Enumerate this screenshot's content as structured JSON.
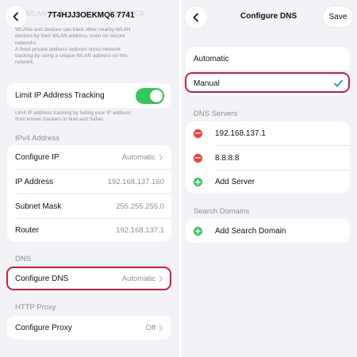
{
  "left": {
    "title": "7T4HJJ3OEKMQ6 7741",
    "title_behind": "WLAN AD    WLAN ADDR    MQG ATCA",
    "privacy_note_line1": "WLANs and devices can track other nearby WLAN",
    "privacy_note_line2": "devices by their WLAN address, even on secure",
    "privacy_note_line3": "networks.",
    "privacy_note_line4": "A fixed private address reduces cross-network",
    "privacy_note_line5": "tracking by using a unique WLAN address on this",
    "privacy_note_line6": "network.",
    "limit_tracking_label": "Limit IP Address Tracking",
    "limit_tracking_enabled": true,
    "limit_note_line1": "Limit IP address tracking by hiding your IP address",
    "limit_note_line2": "from known trackers in Mail and Safari.",
    "ipv4_header": "IPv4 Address",
    "ipv4_rows": [
      {
        "label": "Configure IP",
        "value": "Automatic"
      },
      {
        "label": "IP Address",
        "value": "192.168.137.160"
      },
      {
        "label": "Subnet Mask",
        "value": "255.255.255.0"
      },
      {
        "label": "Router",
        "value": "192.168.137.1"
      }
    ],
    "dns_header": "DNS",
    "configure_dns_label": "Configure DNS",
    "configure_dns_value": "Automatic",
    "proxy_header": "HTTP Proxy",
    "configure_proxy_label": "Configure Proxy",
    "configure_proxy_value": "Off"
  },
  "right": {
    "title": "Configure DNS",
    "save_label": "Save",
    "mode_automatic": "Automatic",
    "mode_manual": "Manual",
    "selected_mode": "Manual",
    "dns_servers_header": "DNS Servers",
    "servers": [
      "192.168.137.1",
      "8.8.8.8"
    ],
    "add_server_label": "Add Server",
    "search_domains_header": "Search Domains",
    "add_search_domain_label": "Add Search Domain"
  },
  "colors": {
    "accent": "#007aff",
    "toggle_on": "#34c759",
    "remove": "#ff3b30",
    "add": "#34c759",
    "highlight": "#d21e3b",
    "background": "#f2f2f7"
  },
  "icons": {
    "back": "chevron-left-icon",
    "disclosure": "chevron-right-icon",
    "checkmark": "checkmark-icon",
    "remove": "minus-circle-icon",
    "add": "plus-circle-icon"
  }
}
